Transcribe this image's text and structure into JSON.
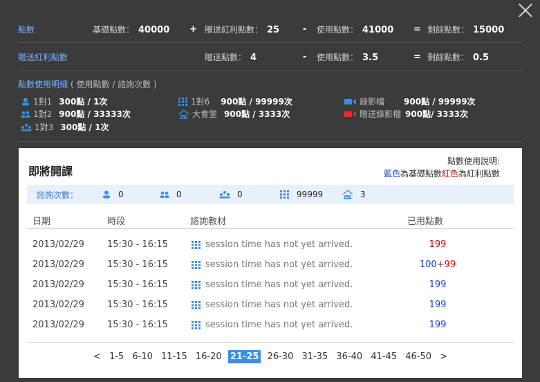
{
  "summary": {
    "points_label": "點數",
    "base_label": "基礎點數：",
    "base_value": "40000",
    "plus": "+",
    "bonus_label": "贈送紅利點數：",
    "bonus_value": "25",
    "minus": "-",
    "used_label": "使用點數：",
    "used_value": "41000",
    "equals": "=",
    "remain_label": "剩餘點數：",
    "remain_value": "15000"
  },
  "bonus": {
    "label": "贈送紅利點數",
    "gift_label": "贈送點數：",
    "gift_value": "4",
    "minus": "-",
    "used_label": "使用點數：",
    "used_value": "3.5",
    "equals": "=",
    "remain_label": "剩餘點數：",
    "remain_value": "0.5"
  },
  "usage": {
    "title": "點數使用明細",
    "subtitle": "( 使用點數 / 諮詢次數 )",
    "items": [
      {
        "icon": "person-icon",
        "label": "1對1",
        "value": "300點 / 1次"
      },
      {
        "icon": "grid-icon",
        "label": "1對6",
        "value": "900點 / 99999次"
      },
      {
        "icon": "video-icon",
        "label": "錄影檔",
        "value": "900點 / 99999次"
      },
      {
        "icon": "two-people-icon",
        "label": "1對2",
        "value": "900點 / 33333次"
      },
      {
        "icon": "hall-icon",
        "label": "大會堂",
        "value": "900點 / 3333次"
      },
      {
        "icon": "gift-video-icon",
        "label": "贈送錄影檔",
        "value": "900點/ 3333次"
      },
      {
        "icon": "three-people-icon",
        "label": "1對3",
        "value": "300點 / 1次"
      }
    ]
  },
  "panel": {
    "title": "即將開課",
    "note_line1": "點數使用說明:",
    "note_blue": "藍色",
    "note_mid": "為基礎點數",
    "note_red": "紅色",
    "note_end": "為紅利點數",
    "counts_label": "諮詢次數：",
    "counts": [
      "0",
      "0",
      "0",
      "99999",
      "3"
    ],
    "headers": {
      "date": "日期",
      "time": "時段",
      "material": "諮詢教材",
      "points": "已用點數"
    },
    "rows": [
      {
        "date": "2013/02/29",
        "time": "15:30 - 16:15",
        "material": "session time has not yet arrived.",
        "points_blue": "",
        "points_sep": "",
        "points_red": "199"
      },
      {
        "date": "2013/02/29",
        "time": "15:30 - 16:15",
        "material": "session time has not yet arrived.",
        "points_blue": "100",
        "points_sep": "+",
        "points_red": "99"
      },
      {
        "date": "2013/02/29",
        "time": "15:30 - 16:15",
        "material": "session time has not yet arrived.",
        "points_blue": "199",
        "points_sep": "",
        "points_red": ""
      },
      {
        "date": "2013/02/29",
        "time": "15:30 - 16:15",
        "material": "session time has not yet arrived.",
        "points_blue": "199",
        "points_sep": "",
        "points_red": ""
      },
      {
        "date": "2013/02/29",
        "time": "15:30 - 16:15",
        "material": "session time has not yet arrived.",
        "points_blue": "199",
        "points_sep": "",
        "points_red": ""
      }
    ],
    "pager": {
      "prev": "<",
      "pages": [
        "1-5",
        "6-10",
        "11-15",
        "16-20",
        "21-25",
        "26-30",
        "31-35",
        "36-40",
        "41-45",
        "46-50"
      ],
      "active": "21-25",
      "next": ">"
    }
  },
  "colors": {
    "accent": "#3a8ee6",
    "blue": "#1a3ecf",
    "red": "#d40000",
    "link": "#6fb0ff"
  }
}
